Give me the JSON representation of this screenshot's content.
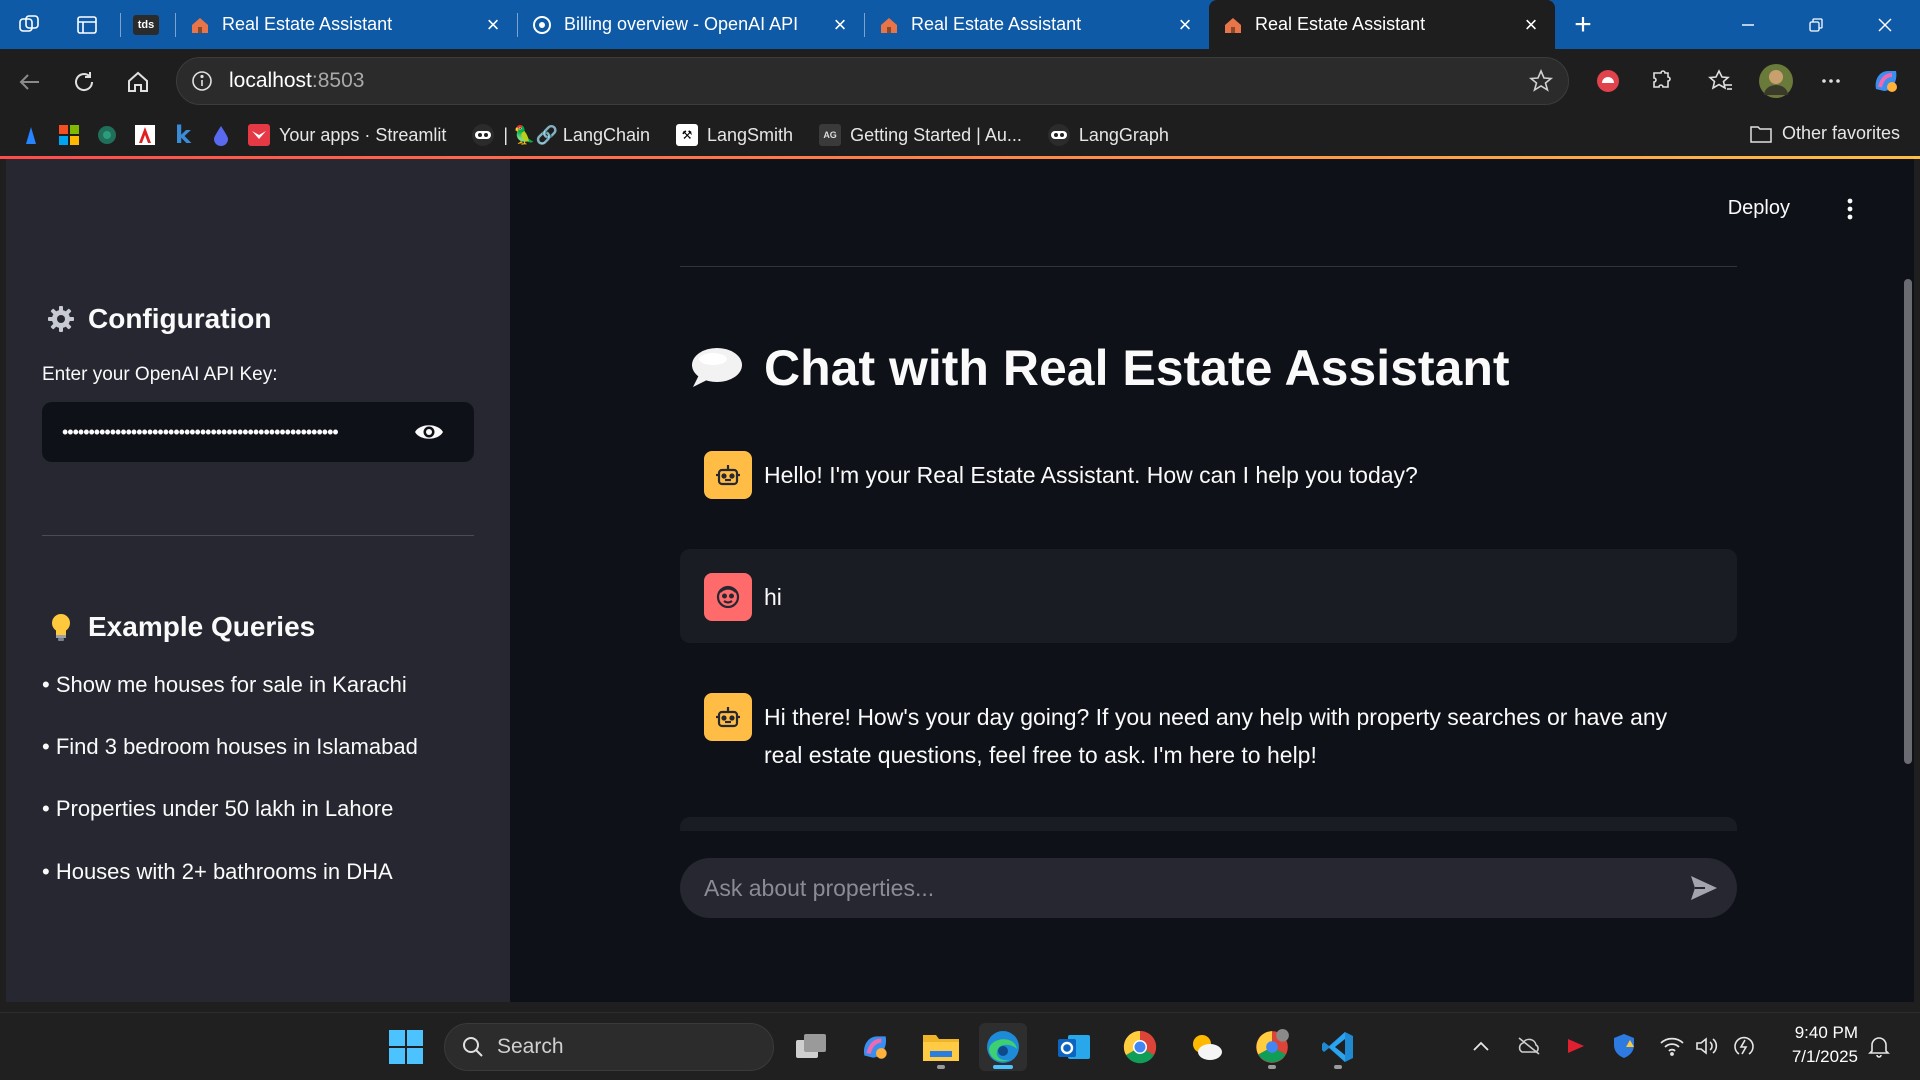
{
  "browser": {
    "tabs": [
      {
        "title": "Real Estate Assistant",
        "close": "×"
      },
      {
        "title": "Billing overview - OpenAI API",
        "close": "×"
      },
      {
        "title": "Real Estate Assistant",
        "close": "×"
      },
      {
        "title": "Real Estate Assistant",
        "close": "×",
        "active": true
      }
    ],
    "tds_label": "tds",
    "new_tab": "+",
    "address": {
      "host": "localhost",
      "port": ":8503"
    },
    "favorites": [
      {
        "label": "Your apps · Streamlit"
      },
      {
        "label": "| 🦜🔗 LangChain"
      },
      {
        "label": "LangSmith"
      },
      {
        "label": "Getting Started | Au..."
      },
      {
        "label": "LangGraph"
      }
    ],
    "favorites_k": "k",
    "other_favorites": "Other favorites"
  },
  "sidebar": {
    "config_title": "Configuration",
    "api_label": "Enter your OpenAI API Key:",
    "api_value": "••••••••••••••••••••••••••••••••••••••••••••••••••••",
    "examples_title": "Example Queries",
    "examples": [
      "• Show me houses for sale in Karachi",
      "• Find 3 bedroom houses in Islamabad",
      "• Properties under 50 lakh in Lahore",
      "• Houses with 2+ bathrooms in DHA"
    ]
  },
  "main": {
    "deploy": "Deploy",
    "title": "Chat with Real Estate Assistant",
    "messages": [
      {
        "role": "assistant",
        "text": "Hello! I'm your Real Estate Assistant. How can I help you today?"
      },
      {
        "role": "user",
        "text": "hi"
      },
      {
        "role": "assistant",
        "text": "Hi there! How's your day going? If you need any help with property searches or have any real estate questions, feel free to ask. I'm here to help!"
      }
    ],
    "input_placeholder": "Ask about properties..."
  },
  "taskbar": {
    "search": "Search",
    "time": "9:40 PM",
    "date": "7/1/2025"
  },
  "colors": {
    "browser_chrome": "#0e5aa7",
    "page_bg": "#0e1117",
    "sidebar_bg": "#262730",
    "bot_avatar": "#ffbd45",
    "user_avatar": "#ff6b6b"
  }
}
